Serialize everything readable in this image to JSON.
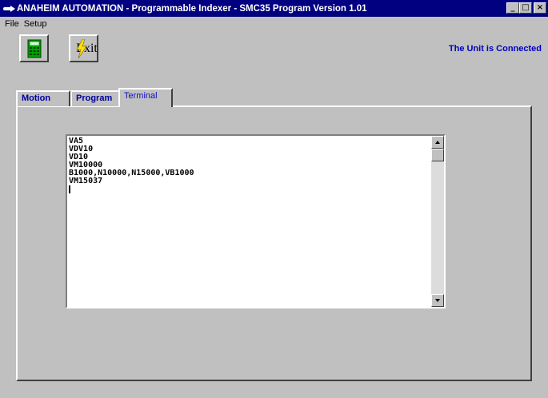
{
  "window": {
    "title": "ANAHEIM AUTOMATION - Programmable Indexer - SMC35 Program Version 1.01",
    "minimize_label": "_",
    "maximize_label": "□",
    "close_label": "×"
  },
  "menu": {
    "items": [
      "File",
      "Setup"
    ]
  },
  "toolbar": {
    "calculator_icon": "calculator-icon",
    "exit_label": "Exit"
  },
  "status": {
    "connection": "The Unit is Connected"
  },
  "tabs": [
    {
      "label": "Motion",
      "active": false
    },
    {
      "label": "Program",
      "active": false
    },
    {
      "label": "Terminal",
      "active": true
    }
  ],
  "terminal": {
    "lines": [
      "VA5",
      "VDV10",
      "VD10",
      "VM10000",
      "B1000,N10000,N15000,VB1000",
      "VM15037"
    ]
  },
  "colors": {
    "title_bar": "#000080",
    "window_face": "#c0c0c0",
    "status_text": "#0000c0",
    "tab_text": "#0000a0"
  }
}
